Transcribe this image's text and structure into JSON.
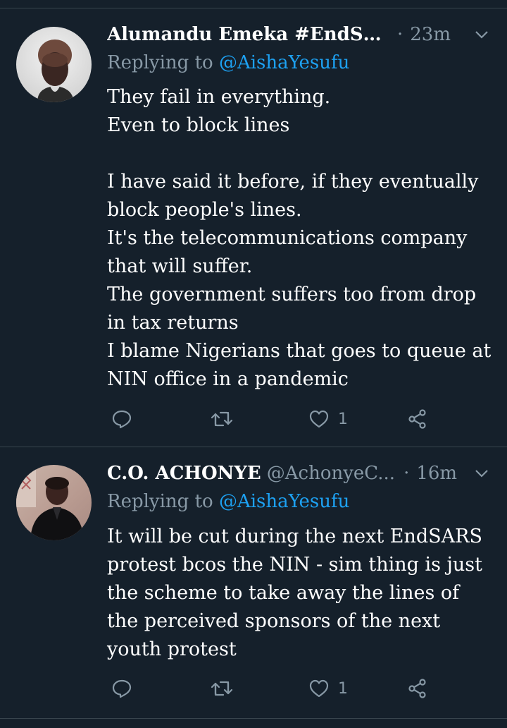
{
  "tweets": [
    {
      "name": "Alumandu Emeka #EndSA...",
      "handle": "",
      "time": "23m",
      "replying_prefix": "Replying to",
      "replying_to": "@AishaYesufu",
      "text": "They fail in everything.\nEven to block lines\n\nI have said it before, if they eventually block people's lines.\nIt's the telecommunications company that will suffer.\nThe government suffers too from drop in tax returns\nI blame Nigerians that goes to queue at NIN office in a pandemic",
      "like_count": "1",
      "icons": [
        "reply-icon",
        "retweet-icon",
        "like-icon",
        "share-icon",
        "chevron-down-icon"
      ]
    },
    {
      "name": "C.O. ACHONYE",
      "handle": "@AchonyeC...",
      "time": "16m",
      "replying_prefix": "Replying to",
      "replying_to": "@AishaYesufu",
      "text": "It will be cut during the next EndSARS protest bcos the NIN - sim thing is just the scheme to take away the lines of the perceived sponsors of the next youth protest",
      "like_count": "1",
      "icons": [
        "reply-icon",
        "retweet-icon",
        "like-icon",
        "share-icon",
        "chevron-down-icon"
      ]
    }
  ],
  "colors": {
    "background": "#15202b",
    "divider": "#38444d",
    "secondary_text": "#8899a6",
    "link": "#1da1f2",
    "primary_text": "#ffffff"
  }
}
